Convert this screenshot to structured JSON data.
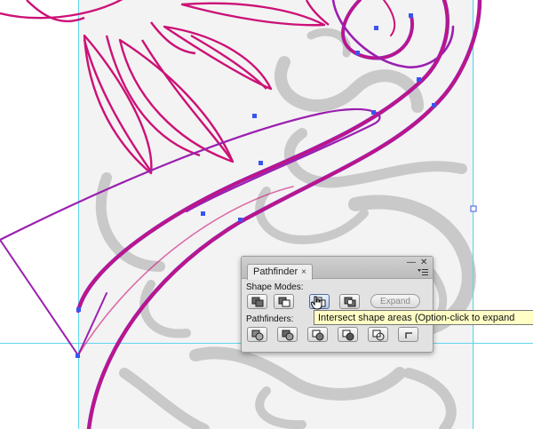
{
  "panel": {
    "tab_label": "Pathfinder",
    "tab_close": "×",
    "minimize_glyph": "—",
    "close_glyph": "✕",
    "menu_icon": "panel-menu-icon",
    "shape_modes_label": "Shape Modes:",
    "pathfinders_label": "Pathfinders:",
    "expand_label": "Expand",
    "shape_mode_buttons": [
      "unite-icon",
      "minus-front-icon",
      "intersect-icon",
      "exclude-icon"
    ],
    "pathfinder_buttons": [
      "divide-icon",
      "trim-icon",
      "merge-icon",
      "crop-icon",
      "outline-icon",
      "minus-back-icon"
    ]
  },
  "tooltip": {
    "text": "Intersect shape areas (Option-click to expand"
  },
  "colors": {
    "path_magenta": "#cc1177",
    "path_purple": "#9b1fb0",
    "anchor_blue": "#3a55ee",
    "guide_cyan": "#5fd6ec",
    "sketch_gray": "#bfbfbf",
    "tooltip_bg": "#ffffc6"
  }
}
